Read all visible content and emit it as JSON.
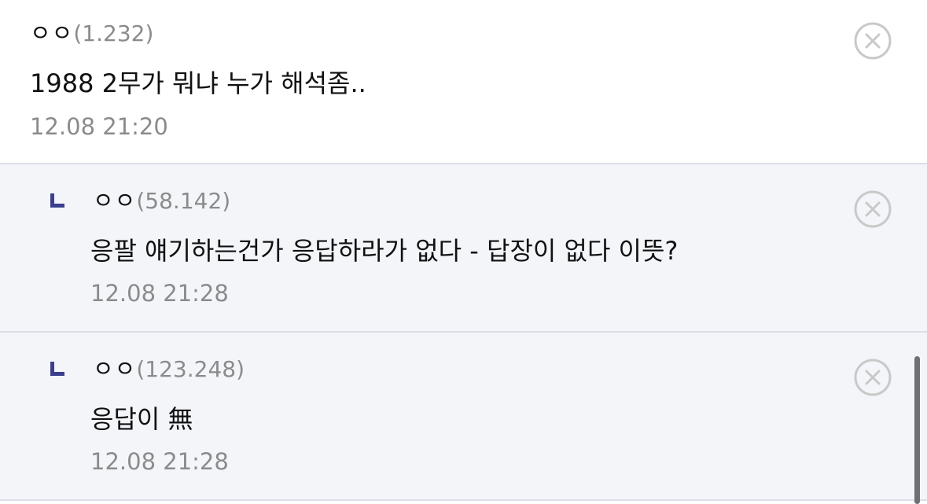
{
  "comments": [
    {
      "author": "ㅇㅇ",
      "ip": "(1.232)",
      "text": "1988 2무가 뭐냐 누가 해석좀..",
      "time": "12.08 21:20"
    },
    {
      "author": "ㅇㅇ",
      "ip": "(58.142)",
      "text": "응팔 얘기하는건가 응답하라가 없다 - 답장이 없다 이뜻?",
      "time": "12.08 21:28"
    },
    {
      "author": "ㅇㅇ",
      "ip": "(123.248)",
      "text": "응답이 無",
      "time": "12.08 21:28"
    }
  ],
  "colors": {
    "reply_marker": "#3a3f8f",
    "reply_background": "#f4f5f9",
    "divider": "#dcdde5",
    "meta_text": "#8b8b8b",
    "delete_icon": "#c9c9c9"
  },
  "icons": {
    "delete": "close-circle-icon",
    "reply": "reply-corner-icon"
  }
}
